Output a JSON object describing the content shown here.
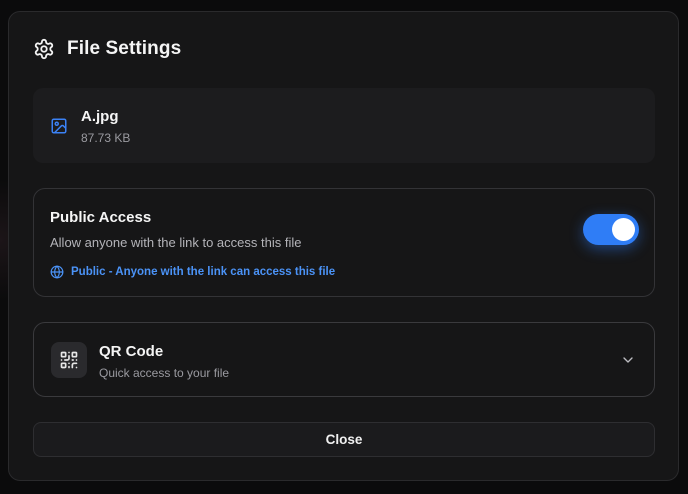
{
  "dialog": {
    "title": "File Settings",
    "title_icon": "gear-icon"
  },
  "file": {
    "icon": "image-file-icon",
    "name": "A.jpg",
    "size": "87.73 KB"
  },
  "public_access": {
    "title": "Public Access",
    "description": "Allow anyone with the link to access this file",
    "status_icon": "globe-icon",
    "status_text": "Public - Anyone with the link can access this file",
    "enabled": true
  },
  "qr_code": {
    "icon": "qr-code-icon",
    "title": "QR Code",
    "subtitle": "Quick access to your file",
    "expand_icon": "chevron-down-icon"
  },
  "actions": {
    "close_label": "Close"
  },
  "colors": {
    "accent": "#2f7df6",
    "link": "#4b93f7",
    "panel": "#161617"
  }
}
